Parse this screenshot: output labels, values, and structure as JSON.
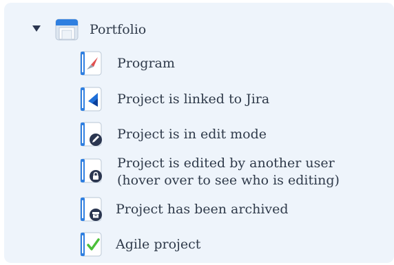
{
  "tree": {
    "root": {
      "label": "Portfolio",
      "icon": "portfolio-folder-icon",
      "expanded": true
    },
    "items": [
      {
        "label": "Program",
        "icon": "program-compass-icon"
      },
      {
        "label": "Project is linked to Jira",
        "icon": "jira-project-icon"
      },
      {
        "label": "Project is in edit mode",
        "icon": "edit-mode-project-icon"
      },
      {
        "label_line1": "Project is edited by another user",
        "label_line2": "(hover over to see who is editing)",
        "icon": "locked-project-icon"
      },
      {
        "label": "Project has been archived",
        "icon": "archived-project-icon"
      },
      {
        "label": "Agile project",
        "icon": "agile-project-icon"
      }
    ]
  },
  "colors": {
    "panel_bg": "#eef4fb",
    "accent_blue": "#2f7fe0",
    "dark_badge": "#2b3650",
    "check_green": "#4bbf3a",
    "compass_red": "#e05050"
  }
}
